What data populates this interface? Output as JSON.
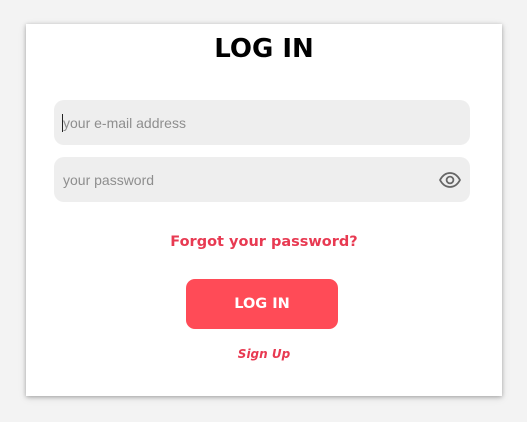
{
  "form": {
    "title": "LOG IN",
    "email": {
      "value": "",
      "placeholder": "your e-mail address"
    },
    "password": {
      "value": "",
      "placeholder": "your password",
      "toggle_icon": "eye-icon"
    },
    "forgot_label": "Forgot your password?",
    "submit_label": "LOG IN",
    "signup_label": "Sign Up"
  },
  "colors": {
    "accent": "#e83a52",
    "button": "#ff4b57",
    "field_bg": "#eeeeee"
  }
}
